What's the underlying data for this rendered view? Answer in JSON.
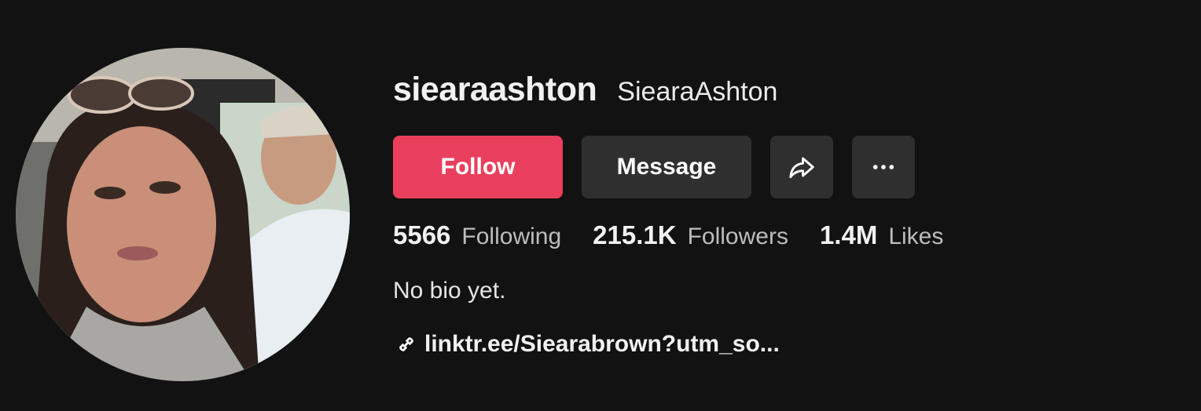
{
  "profile": {
    "username": "siearaashton",
    "nickname": "SiearaAshton",
    "bio": "No bio yet.",
    "link": "linktr.ee/Siearabrown?utm_so..."
  },
  "actions": {
    "follow_label": "Follow",
    "message_label": "Message",
    "share_icon": "share-icon",
    "more_icon": "more-icon"
  },
  "stats": {
    "following": {
      "value": "5566",
      "label": "Following"
    },
    "followers": {
      "value": "215.1K",
      "label": "Followers"
    },
    "likes": {
      "value": "1.4M",
      "label": "Likes"
    }
  },
  "colors": {
    "background": "#121212",
    "follow_button": "#ea3f5c",
    "secondary_button": "#2f2f2f",
    "muted_text": "#bdbdbd"
  }
}
